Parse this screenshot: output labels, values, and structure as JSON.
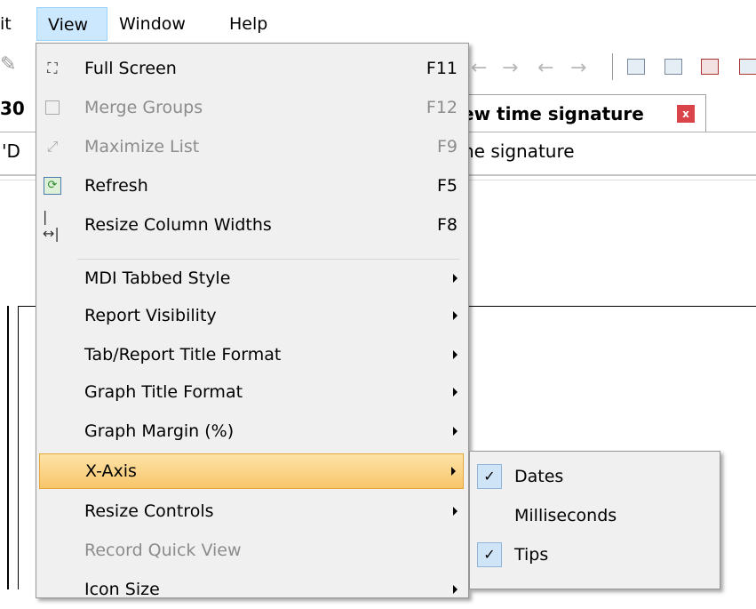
{
  "menubar": {
    "items": [
      {
        "label": "it"
      },
      {
        "label": "View"
      },
      {
        "label": "Window"
      },
      {
        "label": "Help"
      }
    ]
  },
  "tabs": {
    "left_partial": "30",
    "active_title": "ew time signature",
    "close_label": "x"
  },
  "content": {
    "subtitle_left": "'D",
    "subtitle_right": "ne signature"
  },
  "view_menu": {
    "items": [
      {
        "label": "Full Screen",
        "accel": "F11",
        "icon": "full-screen-icon"
      },
      {
        "label": "Merge Groups",
        "accel": "F12",
        "icon": "checkbox-icon",
        "disabled": true
      },
      {
        "label": "Maximize List",
        "accel": "F9",
        "icon": "maximize-icon",
        "disabled": true
      },
      {
        "label": "Refresh",
        "accel": "F5",
        "icon": "refresh-icon"
      },
      {
        "label": "Resize Column Widths",
        "accel": "F8",
        "icon": "resize-columns-icon"
      },
      {
        "label": "MDI Tabbed Style",
        "submenu": true
      },
      {
        "label": "Report Visibility",
        "submenu": true
      },
      {
        "label": "Tab/Report Title Format",
        "submenu": true
      },
      {
        "label": "Graph Title Format",
        "submenu": true
      },
      {
        "label": "Graph Margin (%)",
        "submenu": true
      },
      {
        "label": "X-Axis",
        "submenu": true,
        "highlighted": true
      },
      {
        "label": "Resize Controls",
        "submenu": true
      },
      {
        "label": "Record Quick View",
        "disabled": true
      },
      {
        "label": "Icon Size",
        "submenu": true
      }
    ]
  },
  "xaxis_submenu": {
    "items": [
      {
        "label": "Dates",
        "checked": true
      },
      {
        "label": "Milliseconds",
        "checked": false
      },
      {
        "label": "Tips",
        "checked": true
      }
    ]
  },
  "colors": {
    "highlight": "#f7c66b",
    "menu_bg": "#f0f0f0",
    "tab_close": "#d9434a"
  }
}
